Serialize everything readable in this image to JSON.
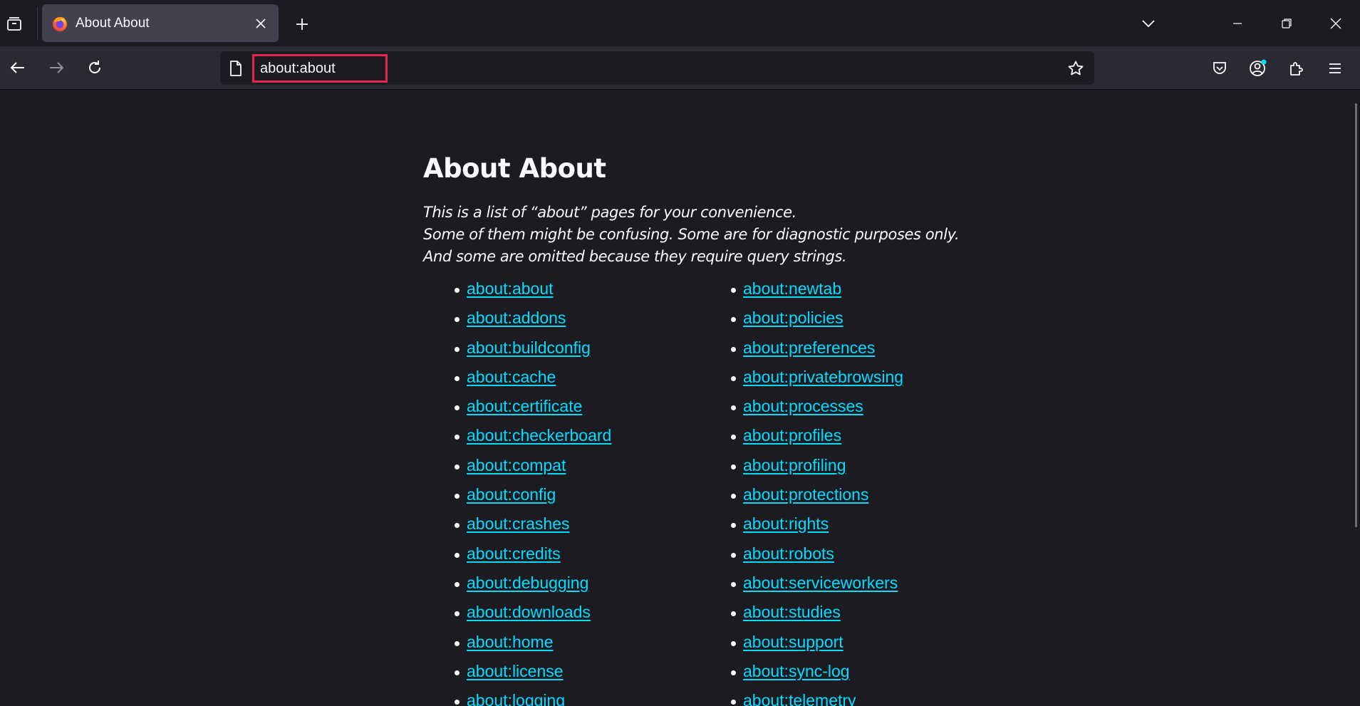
{
  "browser": {
    "tab": {
      "title": "About About"
    },
    "urlbar": {
      "value": "about:about"
    }
  },
  "page": {
    "title": "About About",
    "intro": [
      "This is a list of “about” pages for your convenience.",
      "Some of them might be confusing. Some are for diagnostic purposes only.",
      "And some are omitted because they require query strings."
    ],
    "links_left": [
      "about:about",
      "about:addons",
      "about:buildconfig",
      "about:cache",
      "about:certificate",
      "about:checkerboard",
      "about:compat",
      "about:config",
      "about:crashes",
      "about:credits",
      "about:debugging",
      "about:downloads",
      "about:home",
      "about:license",
      "about:logging"
    ],
    "links_right": [
      "about:newtab",
      "about:policies",
      "about:preferences",
      "about:privatebrowsing",
      "about:processes",
      "about:profiles",
      "about:profiling",
      "about:protections",
      "about:rights",
      "about:robots",
      "about:serviceworkers",
      "about:studies",
      "about:support",
      "about:sync-log",
      "about:telemetry"
    ]
  },
  "icons": {
    "tab_list": "tab-list-icon",
    "favicon": "firefox-logo-icon",
    "close": "close-icon",
    "new_tab": "plus-icon",
    "overflow": "chevron-down-icon",
    "back": "arrow-left-icon",
    "forward": "arrow-right-icon",
    "reload": "reload-icon",
    "page": "page-icon",
    "bookmark": "star-icon",
    "pocket": "pocket-icon",
    "account": "account-icon",
    "extensions": "puzzle-icon",
    "menu": "hamburger-icon"
  },
  "colors": {
    "chrome_bg": "#1c1b22",
    "toolbar_bg": "#2b2a33",
    "tab_selected": "#42414d",
    "link": "#00ddff",
    "highlight_box": "#e22850",
    "account_badge": "#00ddff"
  }
}
